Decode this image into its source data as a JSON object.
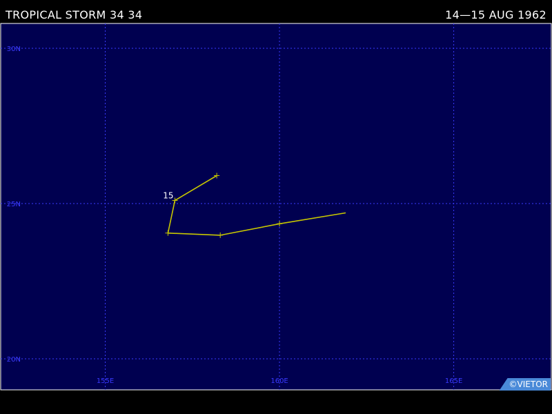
{
  "header": {
    "title": "TROPICAL STORM 34 34",
    "date_range": "14—15 AUG 1962"
  },
  "map": {
    "background_color": "#000050",
    "grid_color": "#3a3aff",
    "track_color": "#c8c800",
    "lon_range_deg_e": [
      152.0,
      167.8
    ],
    "lat_range_deg_n": [
      19.0,
      30.8
    ],
    "lat_labels": [
      {
        "value": 30,
        "text": "30N"
      },
      {
        "value": 25,
        "text": "25N"
      },
      {
        "value": 20,
        "text": "20N"
      }
    ],
    "lon_labels": [
      {
        "value": 155,
        "text": "155E"
      },
      {
        "value": 160,
        "text": "160E"
      },
      {
        "value": 165,
        "text": "165E"
      }
    ],
    "track": [
      {
        "lon": 161.9,
        "lat": 24.7
      },
      {
        "lon": 160.0,
        "lat": 24.35
      },
      {
        "lon": 158.3,
        "lat": 23.98
      },
      {
        "lon": 156.8,
        "lat": 24.05
      },
      {
        "lon": 157.0,
        "lat": 25.1
      },
      {
        "lon": 158.2,
        "lat": 25.9
      }
    ],
    "position_marks": [
      {
        "lon": 160.0,
        "lat": 24.35
      },
      {
        "lon": 158.3,
        "lat": 23.98
      },
      {
        "lon": 156.8,
        "lat": 24.05
      },
      {
        "lon": 157.0,
        "lat": 25.1
      },
      {
        "lon": 158.2,
        "lat": 25.9
      }
    ],
    "day_labels": [
      {
        "lon": 157.0,
        "lat": 25.1,
        "text": "15"
      }
    ]
  },
  "footer": {
    "credit": "©VIETOR"
  }
}
